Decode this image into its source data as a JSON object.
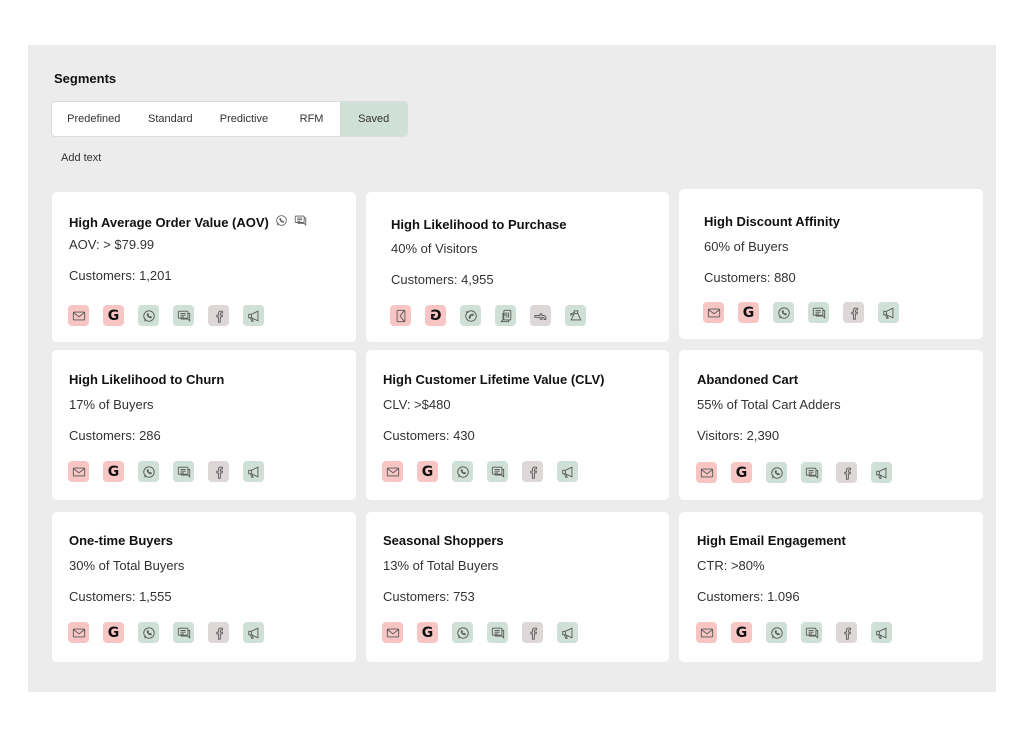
{
  "page": {
    "title": "Segments",
    "add_text": "Add text"
  },
  "tabs": [
    {
      "label": "Predefined",
      "active": false
    },
    {
      "label": "Standard",
      "active": false
    },
    {
      "label": "Predictive",
      "active": false
    },
    {
      "label": "RFM",
      "active": false
    },
    {
      "label": "Saved",
      "active": true
    }
  ],
  "channel_icons": [
    "email-icon",
    "google-icon",
    "whatsapp-icon",
    "sms-chat-icon",
    "facebook-icon",
    "megaphone-icon"
  ],
  "colors": {
    "panel_bg": "#ececec",
    "card_bg": "#ffffff",
    "active_tab": "#cfe0d7",
    "channel_red": "#f7c6c4",
    "channel_green": "#cfe0d7",
    "channel_gray": "#ddd7d7"
  },
  "cards": [
    {
      "title": "High Average Order Value (AOV)",
      "subtitle": "AOV: > $79.99",
      "count": "Customers: 1,201",
      "title_icons": [
        "whatsapp-icon",
        "sms-chat-icon"
      ]
    },
    {
      "title": "High Likelihood to Purchase",
      "subtitle": "40% of Visitors",
      "count": "Customers: 4,955"
    },
    {
      "title": "High Discount Affinity",
      "subtitle": "60% of Buyers",
      "count": "Customers: 880"
    },
    {
      "title": "High Likelihood to Churn",
      "subtitle": "17% of Buyers",
      "count": "Customers: 286"
    },
    {
      "title": "High Customer Lifetime Value (CLV)",
      "subtitle": "CLV: >$480",
      "count": "Customers: 430"
    },
    {
      "title": "Abandoned Cart",
      "subtitle": "55% of Total Cart Adders",
      "count": "Visitors: 2,390"
    },
    {
      "title": "One-time Buyers",
      "subtitle": "30% of Total Buyers",
      "count": "Customers: 1,555"
    },
    {
      "title": "Seasonal Shoppers",
      "subtitle": "13% of Total Buyers",
      "count": "Customers: 753"
    },
    {
      "title": "High Email Engagement",
      "subtitle": "CTR: >80%",
      "count": "Customers: 1.096"
    }
  ]
}
